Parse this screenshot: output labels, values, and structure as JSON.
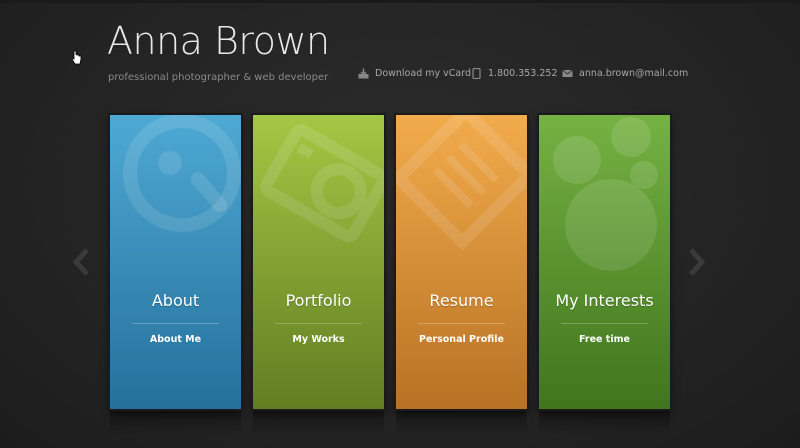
{
  "header": {
    "name": "Anna Brown",
    "tagline": "professional photographer & web developer"
  },
  "contacts": {
    "vcard": {
      "label": "Download my vCard",
      "icon": "download-icon"
    },
    "phone": {
      "label": "1.800.353.252",
      "icon": "phone-icon"
    },
    "email": {
      "label": "anna.brown@mail.com",
      "icon": "mail-icon"
    }
  },
  "tiles": [
    {
      "title": "About",
      "subtitle": "About Me",
      "color": "#3fa2d0",
      "icon": "magnifier-icon"
    },
    {
      "title": "Portfolio",
      "subtitle": "My Works",
      "color": "#9cc334",
      "icon": "camera-icon"
    },
    {
      "title": "Resume",
      "subtitle": "Personal Profile",
      "color": "#f1a43c",
      "icon": "document-icon"
    },
    {
      "title": "My Interests",
      "subtitle": "Free time",
      "color": "#6aab33",
      "icon": "bubbles-icon"
    }
  ],
  "nav": {
    "prev_icon": "chevron-left-icon",
    "next_icon": "chevron-right-icon"
  },
  "colors": {
    "background": "#262626",
    "text": "#e8e8e8",
    "muted": "#8a8a8a"
  }
}
